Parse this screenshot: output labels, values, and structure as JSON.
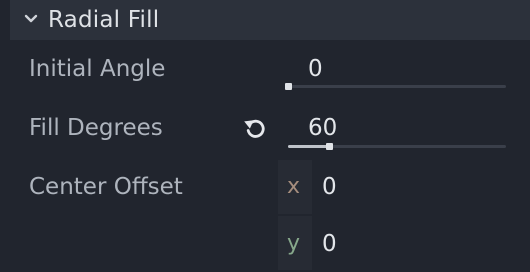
{
  "section": {
    "title": "Radial Fill",
    "icon": "chevron-down-icon"
  },
  "properties": {
    "initial_angle": {
      "label": "Initial Angle",
      "value": "0",
      "slider_fraction": 0
    },
    "fill_degrees": {
      "label": "Fill Degrees",
      "value": "60",
      "slider_fraction": 0.19,
      "revert_icon": "revert-icon"
    },
    "center_offset": {
      "label": "Center Offset",
      "x_axis": "x",
      "x_value": "0",
      "y_axis": "y",
      "y_value": "0"
    }
  },
  "colors": {
    "x_axis": "#a58d7d",
    "y_axis": "#87a88b"
  }
}
